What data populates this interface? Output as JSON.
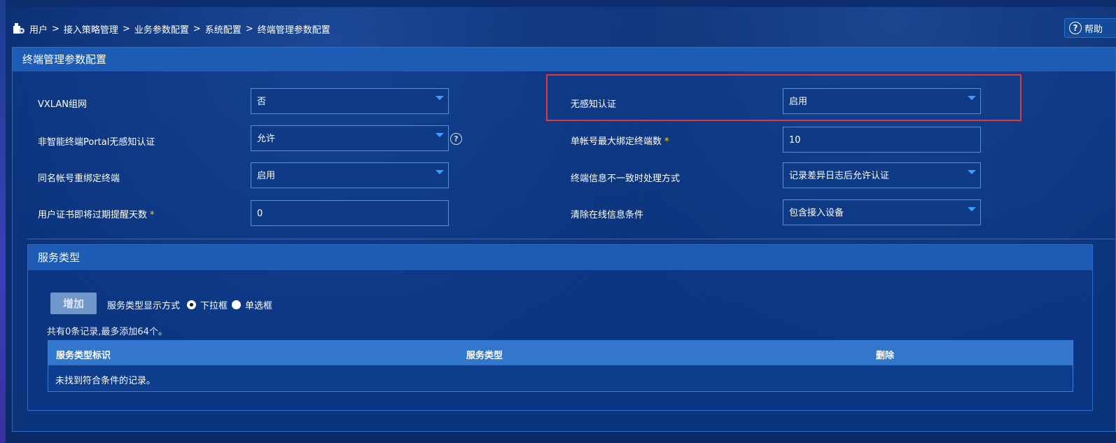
{
  "breadcrumb": {
    "items": [
      "用户",
      "接入策略管理",
      "业务参数配置",
      "系统配置",
      "终端管理参数配置"
    ],
    "separator": ">"
  },
  "help": {
    "label": "帮助"
  },
  "panel": {
    "title": "终端管理参数配置"
  },
  "form": {
    "vxlan": {
      "label": "VXLAN组网",
      "value": "否"
    },
    "portal_noninteractive": {
      "label": "非智能终端Portal无感知认证",
      "value": "允许"
    },
    "rebind_same_account": {
      "label": "同名帐号重绑定终端",
      "value": "启用"
    },
    "cert_expiry_days": {
      "label": "用户证书即将过期提醒天数",
      "required": "*",
      "value": "0"
    },
    "seamless_auth": {
      "label": "无感知认证",
      "value": "启用"
    },
    "max_bind_terminals": {
      "label": "单帐号最大绑定终端数",
      "required": "*",
      "value": "10"
    },
    "mismatch_handling": {
      "label": "终端信息不一致时处理方式",
      "value": "记录差异日志后允许认证"
    },
    "clear_online_condition": {
      "label": "清除在线信息条件",
      "value": "包含接入设备"
    }
  },
  "service": {
    "title": "服务类型",
    "add_label": "增加",
    "display_mode_label": "服务类型显示方式",
    "options": [
      "下拉框",
      "单选框"
    ],
    "selected": "下拉框",
    "count_text": "共有0条记录,最多添加64个。",
    "columns": [
      "服务类型标识",
      "服务类型",
      "删除"
    ],
    "empty_text": "未找到符合条件的记录。"
  }
}
